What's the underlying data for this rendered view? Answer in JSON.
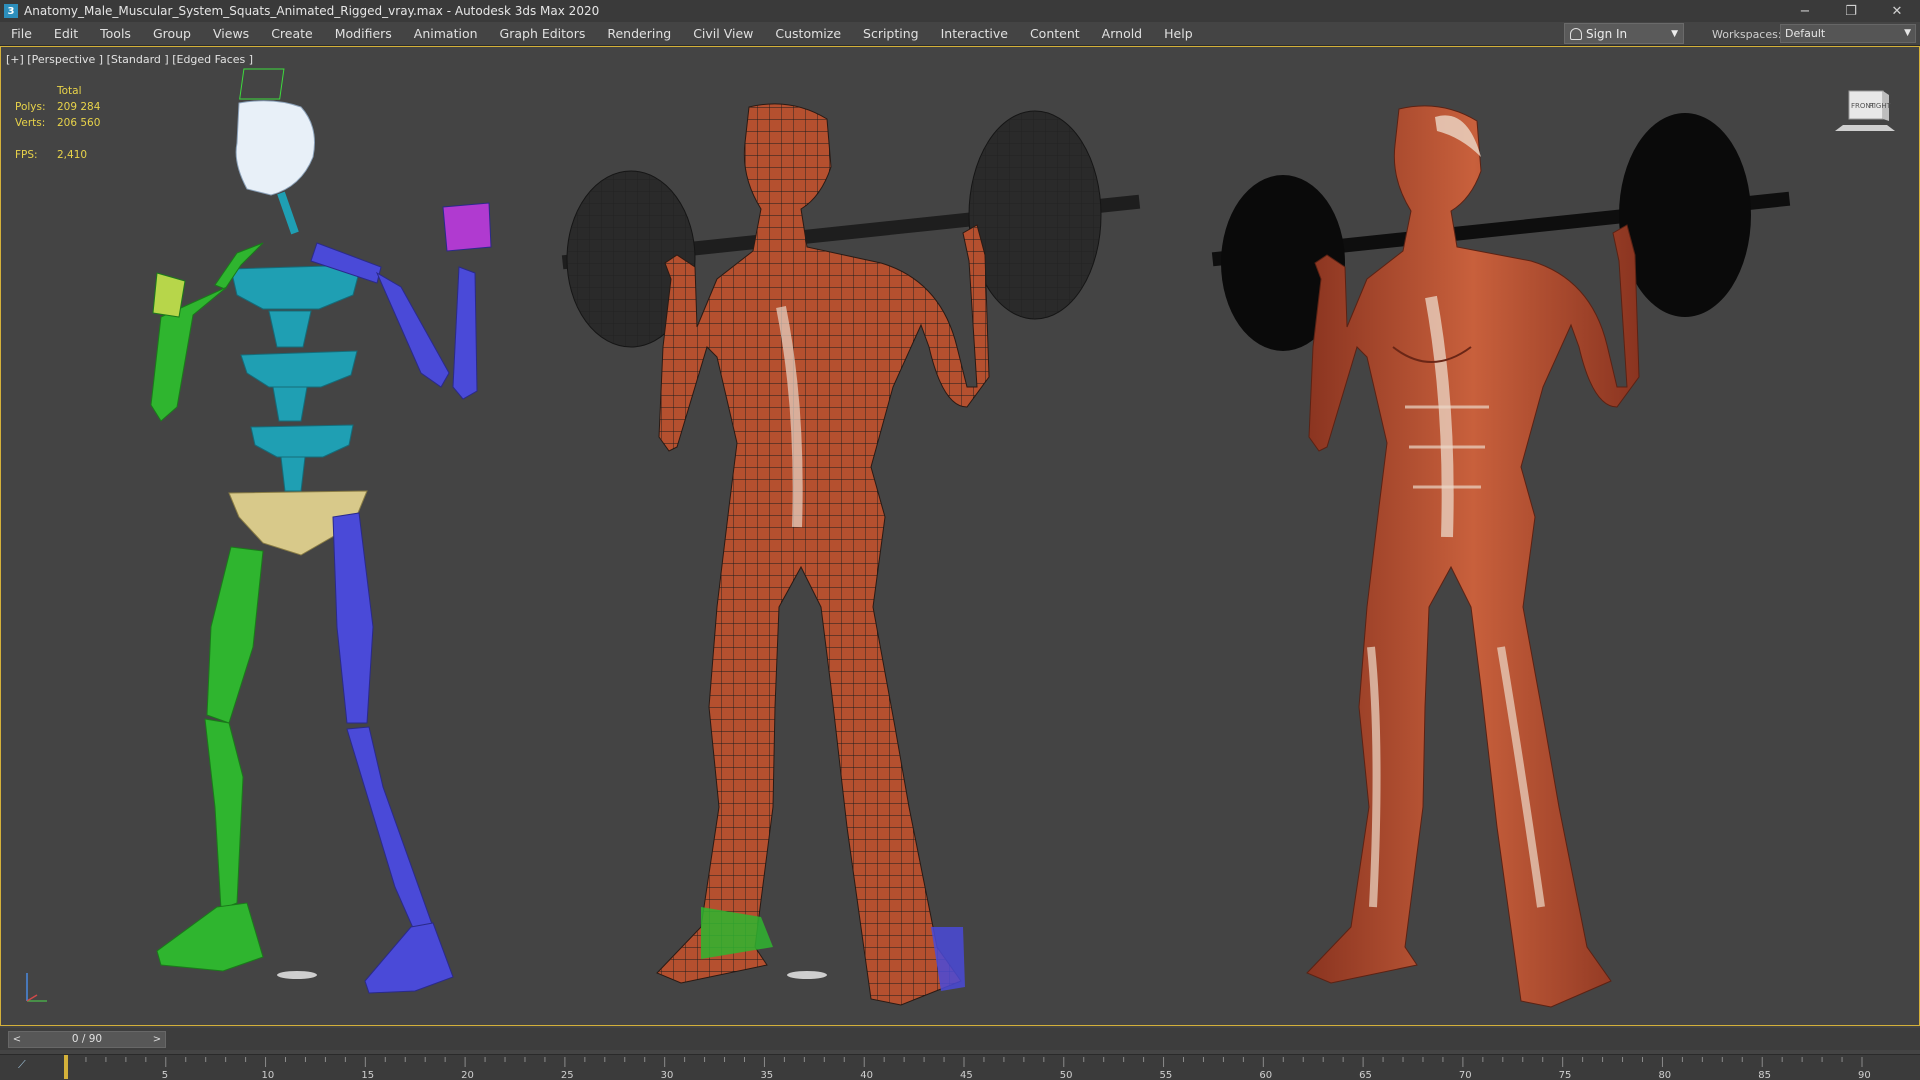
{
  "window": {
    "app_icon": "3",
    "title": "Anatomy_Male_Muscular_System_Squats_Animated_Rigged_vray.max - Autodesk 3ds Max 2020",
    "controls": {
      "minimize": "−",
      "restore": "❐",
      "close": "✕"
    }
  },
  "menu": {
    "items": [
      "File",
      "Edit",
      "Tools",
      "Group",
      "Views",
      "Create",
      "Modifiers",
      "Animation",
      "Graph Editors",
      "Rendering",
      "Civil View",
      "Customize",
      "Scripting",
      "Interactive",
      "Content",
      "Arnold",
      "Help"
    ]
  },
  "account": {
    "sign_in": "Sign In"
  },
  "workspaces": {
    "label": "Workspaces:",
    "value": "Default"
  },
  "viewport": {
    "label": "[+] [Perspective ] [Standard ] [Edged Faces ]",
    "stats": {
      "header": "Total",
      "polys_label": "Polys:",
      "polys_value": "209 284",
      "verts_label": "Verts:",
      "verts_value": "206 560",
      "fps_label": "FPS:",
      "fps_value": "2,410"
    },
    "viewcube": {
      "front": "FRONT",
      "right": "RIGHT"
    }
  },
  "timeline": {
    "prev": "<",
    "next": ">",
    "frame": "0 / 90",
    "ticks": [
      "5",
      "10",
      "15",
      "20",
      "25",
      "30",
      "35",
      "40",
      "45",
      "50",
      "55",
      "60",
      "65",
      "70",
      "75",
      "80",
      "85",
      "90"
    ],
    "max_frame": 90,
    "current_frame": 0
  },
  "colors": {
    "viewport_bg": "#444444",
    "active_border": "#d4b13a",
    "stats_text": "#e8d34a",
    "biped_left": "#2fb52f",
    "biped_right": "#4a4ad8",
    "biped_spine": "#1f9fb3",
    "biped_pelvis": "#d8c98a",
    "muscle": "#b5502f"
  },
  "icons": {
    "app": "3ds-max-logo-icon",
    "user": "user-icon",
    "viewcube": "viewcube-icon",
    "axis": "axis-tripod-icon",
    "curve": "mini-curve-editor-icon"
  }
}
